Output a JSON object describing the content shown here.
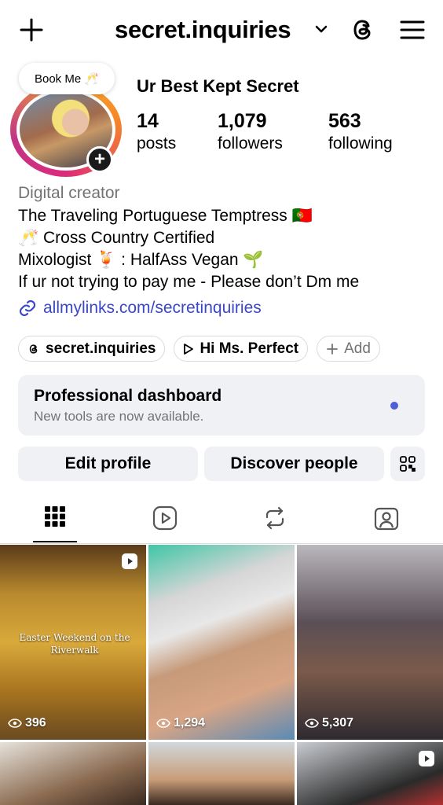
{
  "header": {
    "username": "secret.inquiries"
  },
  "profile": {
    "note": "Book Me 🥂",
    "display_name": "Ur Best Kept Secret",
    "stats": [
      {
        "value": "14",
        "label": "posts"
      },
      {
        "value": "1,079",
        "label": "followers"
      },
      {
        "value": "563",
        "label": "following"
      }
    ],
    "category": "Digital creator",
    "bio_lines": [
      "The Traveling Portuguese Temptress 🇵🇹",
      "🥂 Cross Country Certified",
      "Mixologist 🍹 : HalfAss Vegan 🌱",
      "If ur not trying to pay me - Please don’t Dm me"
    ],
    "link": "allmylinks.com/secretinquiries"
  },
  "chips": [
    {
      "label": "secret.inquiries"
    },
    {
      "label": "Hi Ms. Perfect"
    },
    {
      "label": "Add"
    }
  ],
  "dashboard": {
    "title": "Professional dashboard",
    "subtitle": "New tools are now available.",
    "dot_color": "#4c5fd7"
  },
  "actions": {
    "edit": "Edit profile",
    "discover": "Discover people"
  },
  "grid": [
    {
      "views": "396",
      "caption": "Easter Weekend on the Riverwalk",
      "is_reel": true
    },
    {
      "views": "1,294",
      "caption": "",
      "is_reel": false
    },
    {
      "views": "5,307",
      "caption": "",
      "is_reel": false
    },
    {
      "views": "",
      "caption": "",
      "is_reel": false
    },
    {
      "views": "",
      "caption": "",
      "is_reel": false
    },
    {
      "views": "",
      "caption": "",
      "is_reel": true
    }
  ],
  "colors": {
    "link": "#3a47c7",
    "muted_text": "#737373",
    "button_bg": "#eff1f5"
  },
  "icons": [
    "plus-icon",
    "chevron-down-icon",
    "threads-icon",
    "menu-icon",
    "link-icon",
    "play-icon",
    "qr-code-icon",
    "grid-icon",
    "reels-icon",
    "reposts-icon",
    "tagged-icon",
    "eye-icon"
  ]
}
